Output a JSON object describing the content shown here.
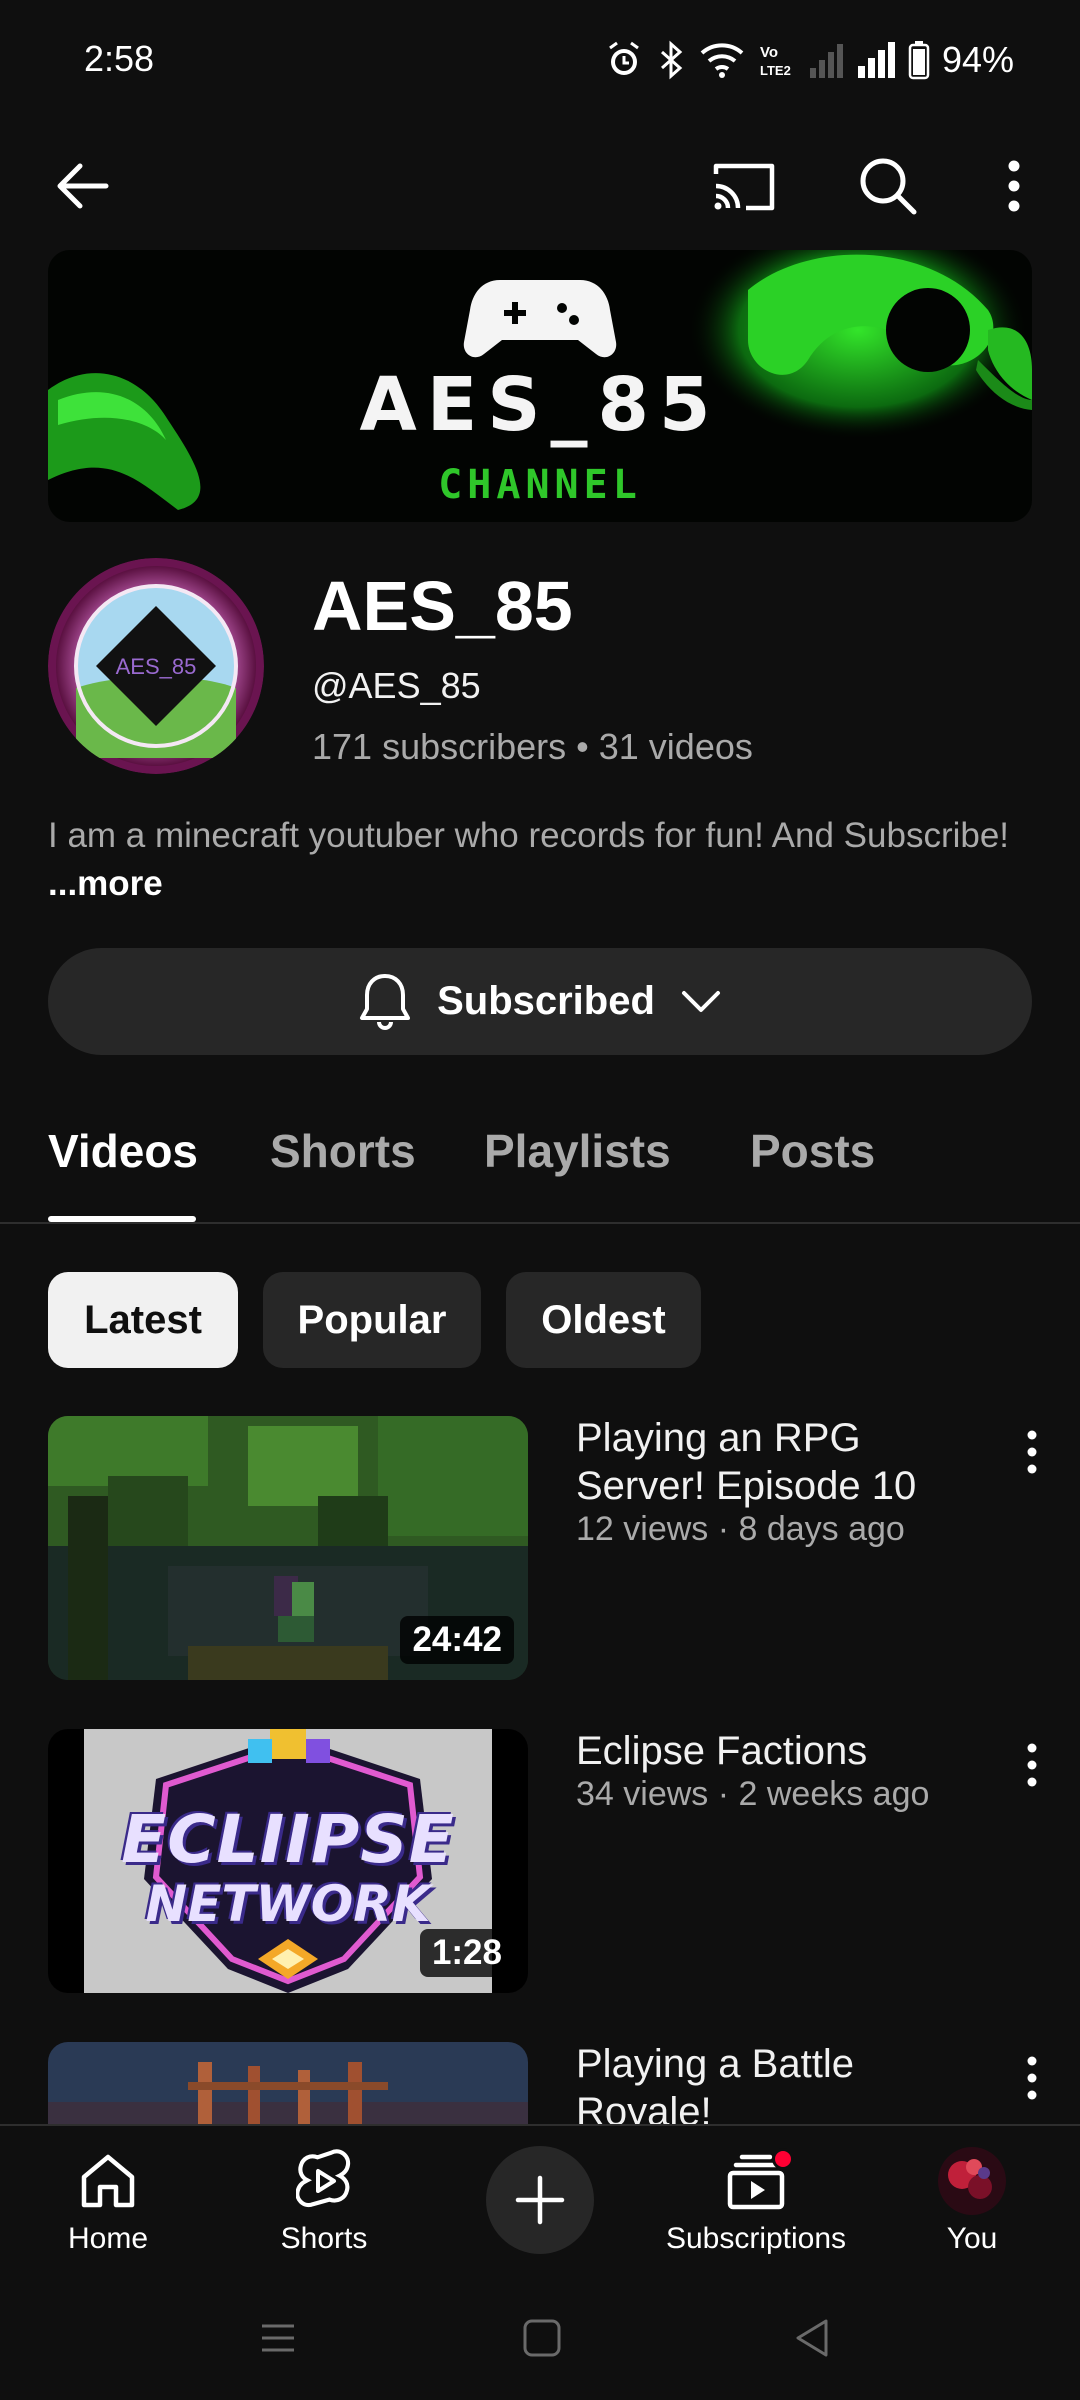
{
  "status_bar": {
    "time": "2:58",
    "battery": "94%"
  },
  "banner": {
    "title": "AES_85",
    "subtitle": "CHANNEL"
  },
  "channel": {
    "name": "AES_85",
    "handle": "@AES_85",
    "avatar_text": "AES_85",
    "subscribers": "171 subscribers",
    "separator": " • ",
    "videos": "31 videos",
    "description": "I am a minecraft youtuber who records for fun! And Subscribe! ",
    "more_label": "...more"
  },
  "subscribe": {
    "label": "Subscribed"
  },
  "tabs": [
    {
      "label": "Videos",
      "active": true
    },
    {
      "label": "Shorts",
      "active": false
    },
    {
      "label": "Playlists",
      "active": false
    },
    {
      "label": "Posts",
      "active": false
    }
  ],
  "chips": [
    {
      "label": "Latest",
      "active": true
    },
    {
      "label": "Popular",
      "active": false
    },
    {
      "label": "Oldest",
      "active": false
    }
  ],
  "videos": [
    {
      "title": "Playing an RPG Server! Episode 10",
      "meta": "12 views · 8 days ago",
      "duration": "24:42"
    },
    {
      "title": "Eclipse Factions",
      "meta": "34 views · 2 weeks ago",
      "duration": "1:28",
      "thumb_text_1": "ECLIIPSE",
      "thumb_text_2": "NETWORK"
    },
    {
      "title": "Playing a Battle Royale!",
      "meta": "",
      "duration": ""
    }
  ],
  "bottom_nav": {
    "home": "Home",
    "shorts": "Shorts",
    "subscriptions": "Subscriptions",
    "you": "You"
  },
  "colors": {
    "background": "#0f0f0f",
    "surface": "#272727",
    "secondary_text": "#aaaaaa",
    "banner_green": "#2fc72a",
    "notification_red": "#ff0033"
  }
}
